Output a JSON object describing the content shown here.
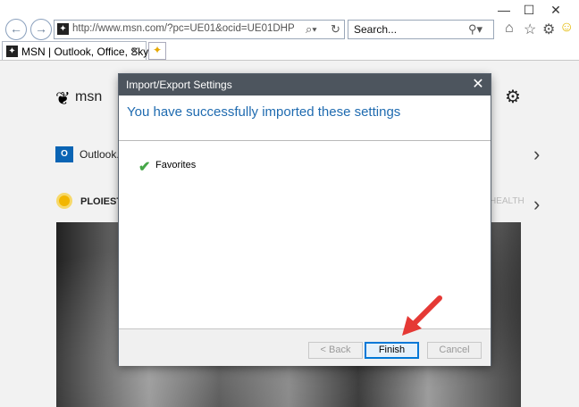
{
  "browser": {
    "address": "http://www.msn.com/?pc=UE01&ocid=UE01DHP",
    "search_placeholder": "Search...",
    "tab_title": "MSN | Outlook, Office, Sky...",
    "window_controls": [
      "minimize",
      "maximize",
      "close"
    ],
    "toolbar_icons": [
      "home-icon",
      "star-icon",
      "gear-icon",
      "smiley-icon"
    ]
  },
  "page": {
    "logo_text": "msn",
    "outlook_label": "Outlook.c",
    "weather_label": "PLOIESTI",
    "health_label": "HEALTH"
  },
  "dialog": {
    "title": "Import/Export Settings",
    "heading": "You have successfully imported these settings",
    "items": [
      "Favorites"
    ],
    "buttons": {
      "back": "< Back",
      "finish": "Finish",
      "cancel": "Cancel"
    }
  },
  "colors": {
    "heading_blue": "#1f6bb0",
    "titlebar": "#4d555e",
    "annotation_red": "#e53935"
  }
}
